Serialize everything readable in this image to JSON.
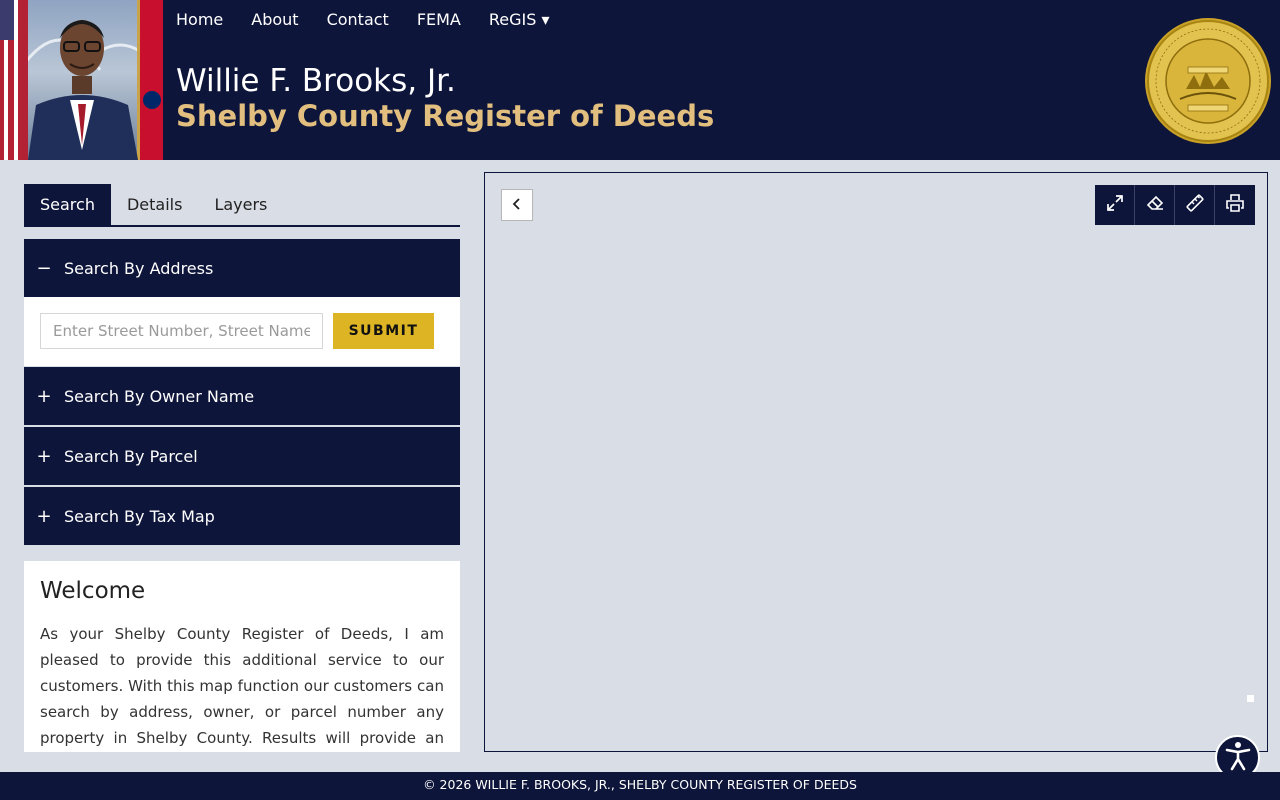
{
  "nav": {
    "items": [
      "Home",
      "About",
      "Contact",
      "FEMA",
      "ReGIS ▾"
    ]
  },
  "header": {
    "name": "Willie F. Brooks, Jr.",
    "office": "Shelby County Register of Deeds",
    "seal_text": "THE SEAL OF SHELBY COUNTY TENNESSEE · AGRICULTURE · COMMERCE · XVI · NOVEMBER 24, 1819"
  },
  "tabs": [
    "Search",
    "Details",
    "Layers"
  ],
  "search": {
    "address": {
      "label": "Search By Address",
      "sign": "−",
      "placeholder": "Enter Street Number, Street Name",
      "submit_label": "SUBMIT"
    },
    "owner": {
      "label": "Search By Owner Name",
      "sign": "+"
    },
    "parcel": {
      "label": "Search By Parcel",
      "sign": "+"
    },
    "taxmap": {
      "label": "Search By Tax Map",
      "sign": "+"
    }
  },
  "welcome": {
    "title": "Welcome",
    "body": "As your Shelby County Register of Deeds, I am pleased to provide this additional service to our customers. With this map function our customers can search by address, owner, or parcel number any property in Shelby County. Results will provide an aerial view of the property along with links to recorded documents."
  },
  "map": {
    "tools": [
      "expand-icon",
      "eraser-icon",
      "ruler-icon",
      "printer-icon"
    ]
  },
  "footer": {
    "text": "© 2026 WILLIE F. BROOKS, JR., SHELBY COUNTY REGISTER OF DEEDS"
  },
  "colors": {
    "navy": "#0e153a",
    "gold": "#e2bf7e",
    "button_gold": "#dcb424",
    "background": "#d9dde6"
  }
}
